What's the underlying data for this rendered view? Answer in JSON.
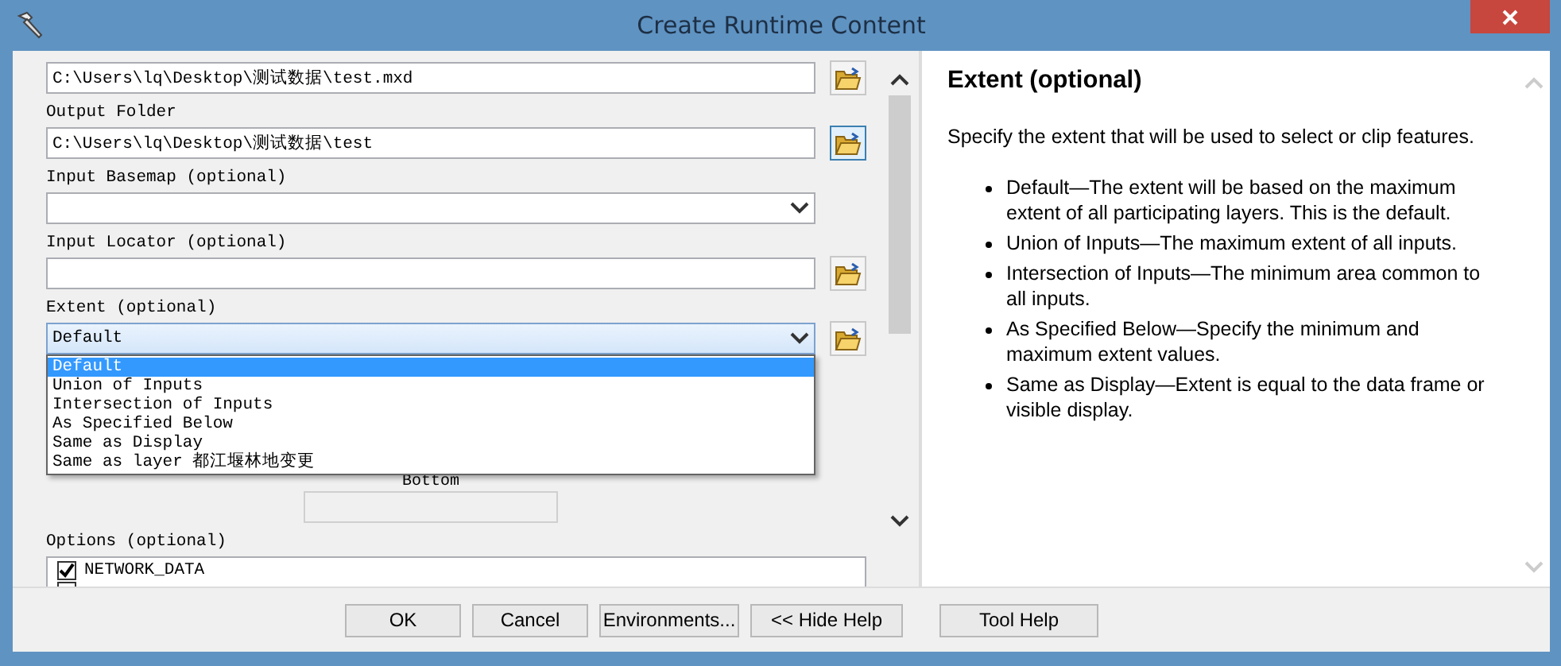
{
  "window": {
    "title": "Create Runtime Content"
  },
  "params": [
    {
      "kind": "path",
      "value": "C:\\Users\\lq\\Desktop\\测试数据\\test.mxd",
      "hovered": false
    },
    {
      "kind": "path",
      "label": "Output Folder",
      "value": "C:\\Users\\lq\\Desktop\\测试数据\\test",
      "hovered": true
    },
    {
      "kind": "combo",
      "label": "Input Basemap (optional)",
      "browse": false,
      "expanded": false
    },
    {
      "kind": "path",
      "label": "Input Locator (optional)",
      "hovered": false
    },
    {
      "kind": "combo",
      "label": "Extent (optional)",
      "value": "Default",
      "browse": true,
      "expanded": true,
      "options": [
        {
          "label": "Default",
          "selected": true
        },
        {
          "label": "Union of Inputs",
          "selected": false
        },
        {
          "label": "Intersection of Inputs",
          "selected": false
        },
        {
          "label": "As Specified Below",
          "selected": false
        },
        {
          "label": "Same as Display",
          "selected": false
        },
        {
          "label": "Same as layer 都江堰林地变更",
          "selected": false
        }
      ]
    },
    {
      "kind": "coord",
      "label": "Bottom"
    },
    {
      "kind": "checklist",
      "label": "Options (optional)",
      "items": [
        {
          "label": "NETWORK_DATA",
          "checked": true
        },
        {
          "checked": false
        }
      ]
    }
  ],
  "help": {
    "title": "Extent (optional)",
    "intro": "Specify the extent that will be used to select or clip features.",
    "bullets": [
      "Default—The extent will be based on the maximum extent of all participating layers. This is the default.",
      "Union of Inputs—The maximum extent of all inputs.",
      "Intersection of Inputs—The minimum area common to all inputs.",
      "As Specified Below—Specify the minimum and maximum extent values.",
      "Same as Display—Extent is equal to the data frame or visible display."
    ]
  },
  "buttons": [
    "OK",
    "Cancel",
    "Environments...",
    "<< Hide Help",
    "Tool Help"
  ]
}
